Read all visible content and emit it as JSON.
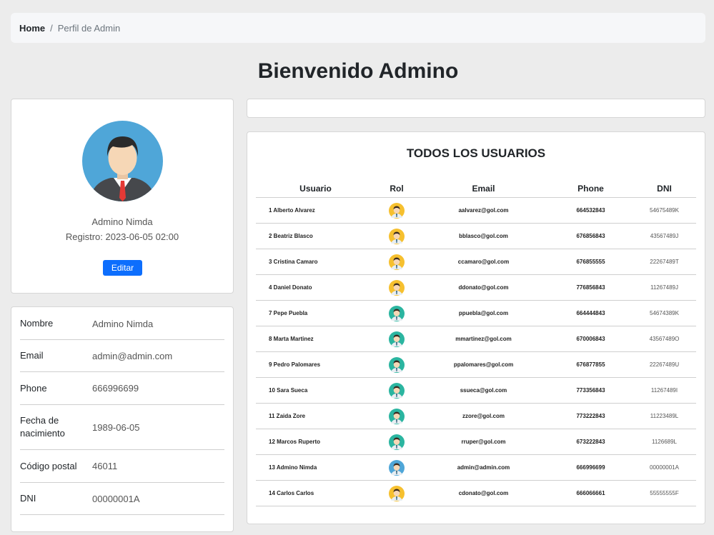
{
  "breadcrumb": {
    "home": "Home",
    "separator": "/",
    "current": "Perfil de Admin"
  },
  "page_title": "Bienvenido Admino",
  "profile": {
    "name": "Admino Nimda",
    "registro": "Registro: 2023-06-05 02:00",
    "edit_label": "Editar"
  },
  "info": [
    {
      "label": "Nombre",
      "value": "Admino Nimda"
    },
    {
      "label": "Email",
      "value": "admin@admin.com"
    },
    {
      "label": "Phone",
      "value": "666996699"
    },
    {
      "label": "Fecha de nacimiento",
      "value": "1989-06-05"
    },
    {
      "label": "Código postal",
      "value": "46011"
    },
    {
      "label": "DNI",
      "value": "00000001A"
    }
  ],
  "users_table": {
    "title": "TODOS LOS USUARIOS",
    "headers": [
      "Usuario",
      "Rol",
      "Email",
      "Phone",
      "DNI"
    ],
    "rows": [
      {
        "usuario": "1 Alberto Alvarez",
        "rol": "yellow-avatar-icon",
        "email": "aalvarez@gol.com",
        "phone": "664532843",
        "dni": "54675489K"
      },
      {
        "usuario": "2 Beatriz Blasco",
        "rol": "yellow-avatar-icon",
        "email": "bblasco@gol.com",
        "phone": "676856843",
        "dni": "43567489J"
      },
      {
        "usuario": "3 Cristina Camaro",
        "rol": "yellow-avatar-icon",
        "email": "ccamaro@gol.com",
        "phone": "676855555",
        "dni": "22267489T"
      },
      {
        "usuario": "4 Daniel Donato",
        "rol": "yellow-avatar-icon",
        "email": "ddonato@gol.com",
        "phone": "776856843",
        "dni": "11267489J"
      },
      {
        "usuario": "7 Pepe Puebla",
        "rol": "teal-avatar-icon",
        "email": "ppuebla@gol.com",
        "phone": "664444843",
        "dni": "54674389K"
      },
      {
        "usuario": "8 Marta Martinez",
        "rol": "teal-avatar-icon",
        "email": "mmartinez@gol.com",
        "phone": "670006843",
        "dni": "43567489O"
      },
      {
        "usuario": "9 Pedro Palomares",
        "rol": "teal-avatar-icon",
        "email": "ppalomares@gol.com",
        "phone": "676877855",
        "dni": "22267489U"
      },
      {
        "usuario": "10 Sara Sueca",
        "rol": "teal-avatar-icon",
        "email": "ssueca@gol.com",
        "phone": "773356843",
        "dni": "11267489I"
      },
      {
        "usuario": "11 Zaida Zore",
        "rol": "teal-avatar-icon",
        "email": "zzore@gol.com",
        "phone": "773222843",
        "dni": "11223489L"
      },
      {
        "usuario": "12 Marcos Ruperto",
        "rol": "teal-avatar-icon",
        "email": "rruper@gol.com",
        "phone": "673222843",
        "dni": "1126689L"
      },
      {
        "usuario": "13 Admino Nimda",
        "rol": "blue-avatar-icon",
        "email": "admin@admin.com",
        "phone": "666996699",
        "dni": "00000001A"
      },
      {
        "usuario": "14 Carlos Carlos",
        "rol": "yellow-avatar-icon",
        "email": "cdonato@gol.com",
        "phone": "666066661",
        "dni": "55555555F"
      }
    ]
  },
  "colors": {
    "accent": "#0d6efd",
    "background": "#ececec",
    "avatar_yellow": "#f6c02f",
    "avatar_teal": "#2bb5a0",
    "avatar_blue": "#4fa6d8"
  }
}
